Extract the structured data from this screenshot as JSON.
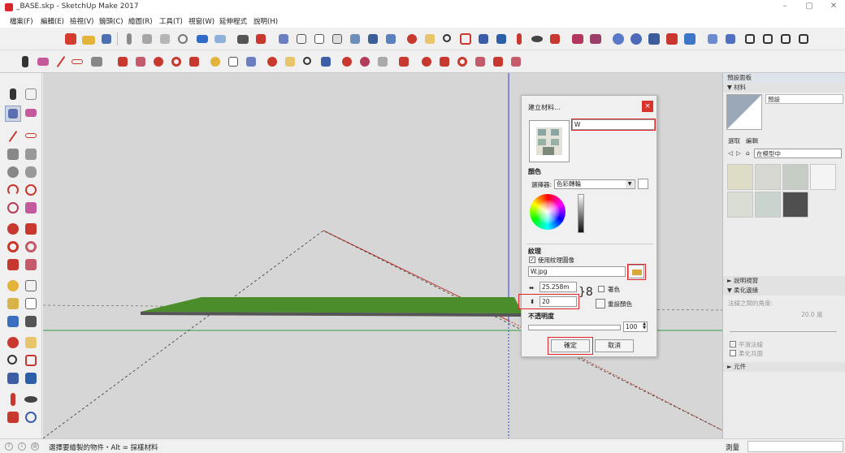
{
  "window": {
    "title": "_BASE.skp - SketchUp Make 2017",
    "minimize": "–",
    "maximize": "▢",
    "close": "✕"
  },
  "menu": [
    "檔案(F)",
    "編輯(E)",
    "檢視(V)",
    "鏡頭(C)",
    "繪圖(R)",
    "工具(T)",
    "視窗(W)",
    "延伸程式",
    "說明(H)"
  ],
  "dialog": {
    "title": "建立材料...",
    "close": "×",
    "name_value": "W",
    "color_section": "顏色",
    "picker_label": "選擇器:",
    "picker_value": "色彩轉輪",
    "texture_section": "紋理",
    "use_texture_label": "使用紋理圖像",
    "use_texture_checked": "✓",
    "texture_file": "W.jpg",
    "width_value": "25.258m",
    "height_value": "20",
    "colorize_label": "著色",
    "reset_color_label": "重設顏色",
    "opacity_section": "不透明度",
    "opacity_value": "100",
    "ok_button": "確定",
    "cancel_button": "取消"
  },
  "right_panel": {
    "tray_title": "預設面板",
    "materials_header": "▼ 材料",
    "preview_label": "預設",
    "tab_select": "選取",
    "tab_edit": "編輯",
    "location": "在模型中",
    "instructor_header": "► 說明視窗",
    "soften_header": "▼ 柔化邊緣",
    "angle_label": "法線之間的角度:",
    "angle_value": "20.0 度",
    "smooth_normals": "平滑法線",
    "soften_coplanar": "柔化共面",
    "components_header": "► 元件"
  },
  "status": {
    "message": "選擇要繪製的物件・Alt = 採樣材料",
    "measure_label": "測量",
    "icon_1": "?",
    "icon_2": "i",
    "icon_3": "@"
  },
  "colors": {
    "highlight": "#e0242a",
    "red_axis": "#c0392b",
    "green_axis": "#2e9e3d",
    "blue_axis": "#2c3ee0",
    "grass": "#4a8d2a"
  }
}
